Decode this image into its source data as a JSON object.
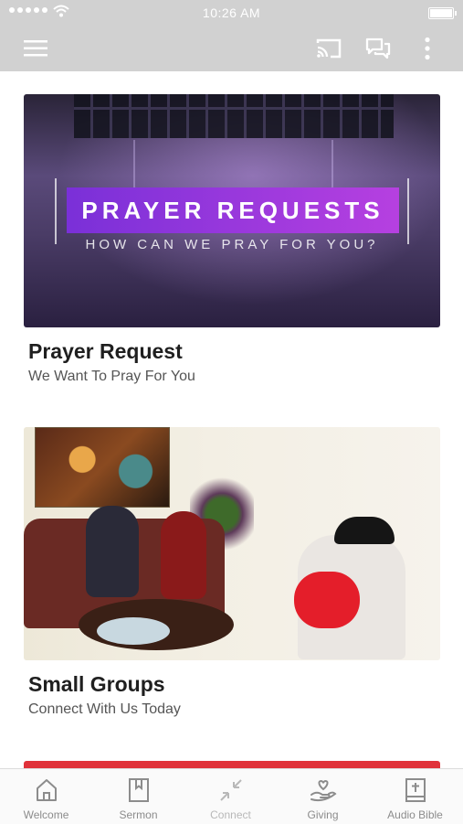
{
  "status_bar": {
    "time": "10:26 AM"
  },
  "app_bar": {
    "icons": [
      "menu-icon",
      "cast-icon",
      "chat-icon",
      "more-vertical-icon"
    ]
  },
  "cards": [
    {
      "banner_title": "PRAYER REQUESTS",
      "banner_subtitle": "HOW CAN WE PRAY FOR YOU?",
      "title": "Prayer Request",
      "subtitle": "We Want To Pray For You"
    },
    {
      "title": "Small Groups",
      "subtitle": "Connect With Us Today"
    }
  ],
  "tab_bar": {
    "tabs": [
      {
        "label": "Welcome",
        "icon": "home-icon"
      },
      {
        "label": "Sermon",
        "icon": "bookmark-book-icon"
      },
      {
        "label": "Connect",
        "icon": "connect-arrows-icon"
      },
      {
        "label": "Giving",
        "icon": "giving-hand-icon"
      },
      {
        "label": "Audio Bible",
        "icon": "bible-icon"
      }
    ]
  },
  "colors": {
    "app_bar": "#d1d1d1",
    "accent_strip": "#e0323a",
    "tab_label": "#8c8c8c"
  }
}
